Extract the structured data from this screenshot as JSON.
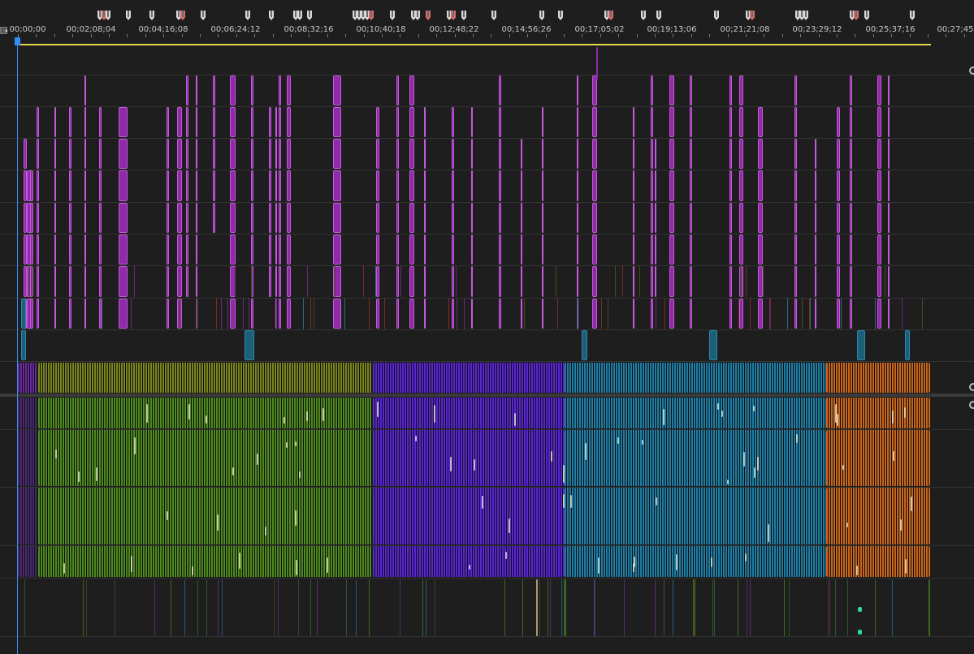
{
  "ruler": {
    "timecodes": [
      "00;00;00",
      "00;02;08;04",
      "00;04;16;08",
      "00;06;24;12",
      "00;08;32;16",
      "00;10;40;18",
      "00;12;48;22",
      "00;14;56;26",
      "00;17;05;02",
      "00;19;13;06",
      "00;21;21;08",
      "00;23;29;12",
      "00;25;37;16",
      "00;27;45"
    ]
  },
  "colors": {
    "background": "#1e1e1e",
    "video_clip": "#8f2aa8",
    "video_clip_border": "#c45adb",
    "audio_green": "#4e8a1c",
    "audio_purple": "#5a25d6",
    "audio_teal": "#1e7ea6",
    "audio_orange": "#c9661c",
    "olive": "#7a861c",
    "marker": "#d8d8d8",
    "marker_red": "#d96b6b",
    "playhead": "#3d8cf0",
    "work_area": "#e6d84a"
  },
  "markers": {
    "icon": "sequence-marker-icon",
    "count": 38
  }
}
